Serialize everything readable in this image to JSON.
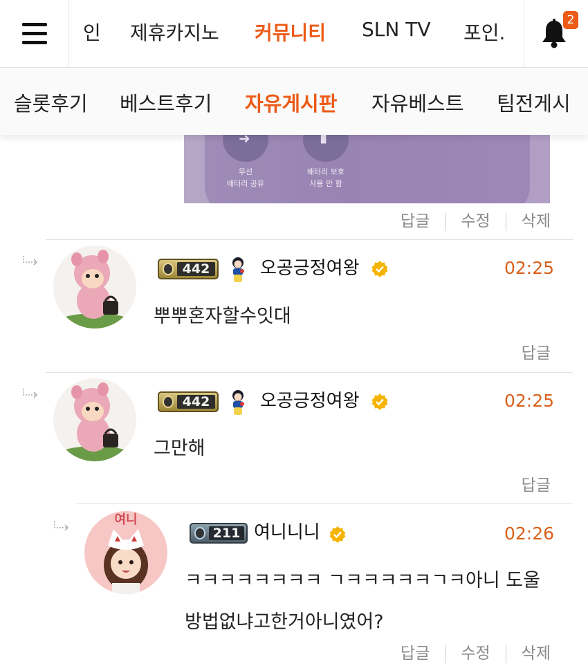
{
  "nav": {
    "tabs": [
      {
        "label": "인",
        "active": false
      },
      {
        "label": "제휴카지노",
        "active": false
      },
      {
        "label": "커뮤니티",
        "active": true
      },
      {
        "label": "SLN TV",
        "active": false
      },
      {
        "label": "포인.",
        "active": false
      }
    ],
    "notification_count": "2"
  },
  "subnav": {
    "tabs": [
      {
        "label": "슬롯후기",
        "active": false
      },
      {
        "label": "베스트후기",
        "active": false
      },
      {
        "label": "자유게시판",
        "active": true
      },
      {
        "label": "자유베스트",
        "active": false
      },
      {
        "label": "팀전게시",
        "active": false
      }
    ]
  },
  "image_card": {
    "left_label_line1": "무선",
    "left_label_line2": "배터리 공유",
    "right_label_line1": "배터리 보호",
    "right_label_line2": "사용 안 함"
  },
  "actions": {
    "reply": "답글",
    "edit": "수정",
    "delete": "삭제"
  },
  "comments": [
    {
      "level": "442",
      "nickname": "오공긍정여왕",
      "time": "02:25",
      "lines": [
        "뿌뿌혼자할수잇대"
      ],
      "own": false
    },
    {
      "level": "442",
      "nickname": "오공긍정여왕",
      "time": "02:25",
      "lines": [
        "그만해"
      ],
      "own": false
    },
    {
      "level": "211",
      "nickname": "여니니니",
      "time": "02:26",
      "lines": [
        "ㅋㅋㅋㅋㅋㅋㅋㅋ ㄱㅋㅋㅋㅋㅋㄱㅋ아니 도울",
        "방법없냐고한거아니였어?"
      ],
      "own": true
    }
  ],
  "avatar2_text": "여니",
  "colors": {
    "accent": "#ec5b18",
    "time": "#d8601b",
    "verified": "#f4b400"
  }
}
